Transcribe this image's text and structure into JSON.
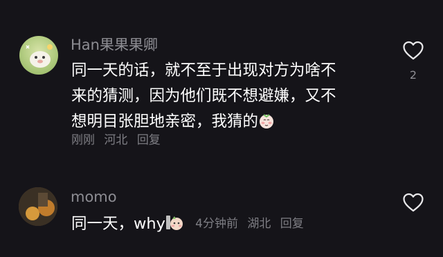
{
  "comments": [
    {
      "username": "Han果果果卿",
      "lines": [
        "同一天的话，就不至于出现对方为啥不",
        "来的猜测，因为他们既不想避嫌，又不",
        "想明目张胆地亲密，我猜的"
      ],
      "time": "刚刚",
      "location": "河北",
      "reply": "回复",
      "like_count": "2",
      "avatar_icon": "cartoon-animal-avatar",
      "emoji_icon": "shy-face-emoji"
    },
    {
      "username": "momo",
      "text_prefix": "同一天，why",
      "time": "4分钟前",
      "location": "湖北",
      "reply": "回复",
      "avatar_icon": "photo-avatar",
      "emoji_icon": "peeking-face-emoji"
    }
  ],
  "colors": {
    "background": "#151419",
    "text": "#ffffff",
    "secondary": "#8d8d93"
  }
}
